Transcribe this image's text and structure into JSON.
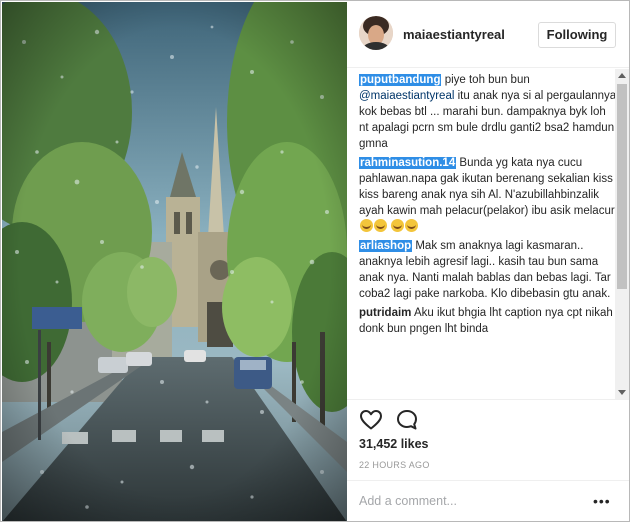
{
  "post": {
    "username": "maiaestiantyreal",
    "follow_label": "Following"
  },
  "comments": [
    {
      "author": "puputbandung",
      "highlighted": true,
      "mention": "@maiaestiantyreal",
      "text_before": "piye toh bun bun",
      "text_after": "itu anak nya si al pergaulannya kok bebas btl ... marahi bun. dampaknya byk loh nt apalagi pcrn sm bule drdlu ganti2 bsa2 hamdun gmna"
    },
    {
      "author": "rahminasution.14",
      "highlighted": true,
      "text": "Bunda yg kata nya cucu pahlawan.napa gak ikutan berenang sekalian kiss kiss bareng anak nya sih Al. N'azubillahbinzalik ayah kawin mah pelacur(pelakor) ibu asik melacur",
      "emoji_count": 4
    },
    {
      "author": "arliashop",
      "highlighted": true,
      "text": "Mak sm anaknya lagi kasmaran.. anaknya lebih agresif lagi.. kasih tau bun sama anak nya. Nanti malah bablas dan bebas lagi. Tar coba2 lagi pake narkoba. Klo dibebasin gtu anak."
    },
    {
      "author": "putridaim",
      "highlighted": false,
      "text": "Aku ikut bhgia lht caption nya cpt nikah donk bun pngen lht binda"
    }
  ],
  "stats": {
    "likes": "31,452 likes",
    "timestamp": "22 HOURS AGO"
  },
  "composer": {
    "placeholder": "Add a comment...",
    "more_label": "•••"
  },
  "icons": {
    "like": "heart-outline-icon",
    "comment": "speech-bubble-icon",
    "more": "more-dots-icon"
  },
  "colors": {
    "highlight": "#2f8ee6",
    "mention": "#003569",
    "muted": "#999999"
  }
}
